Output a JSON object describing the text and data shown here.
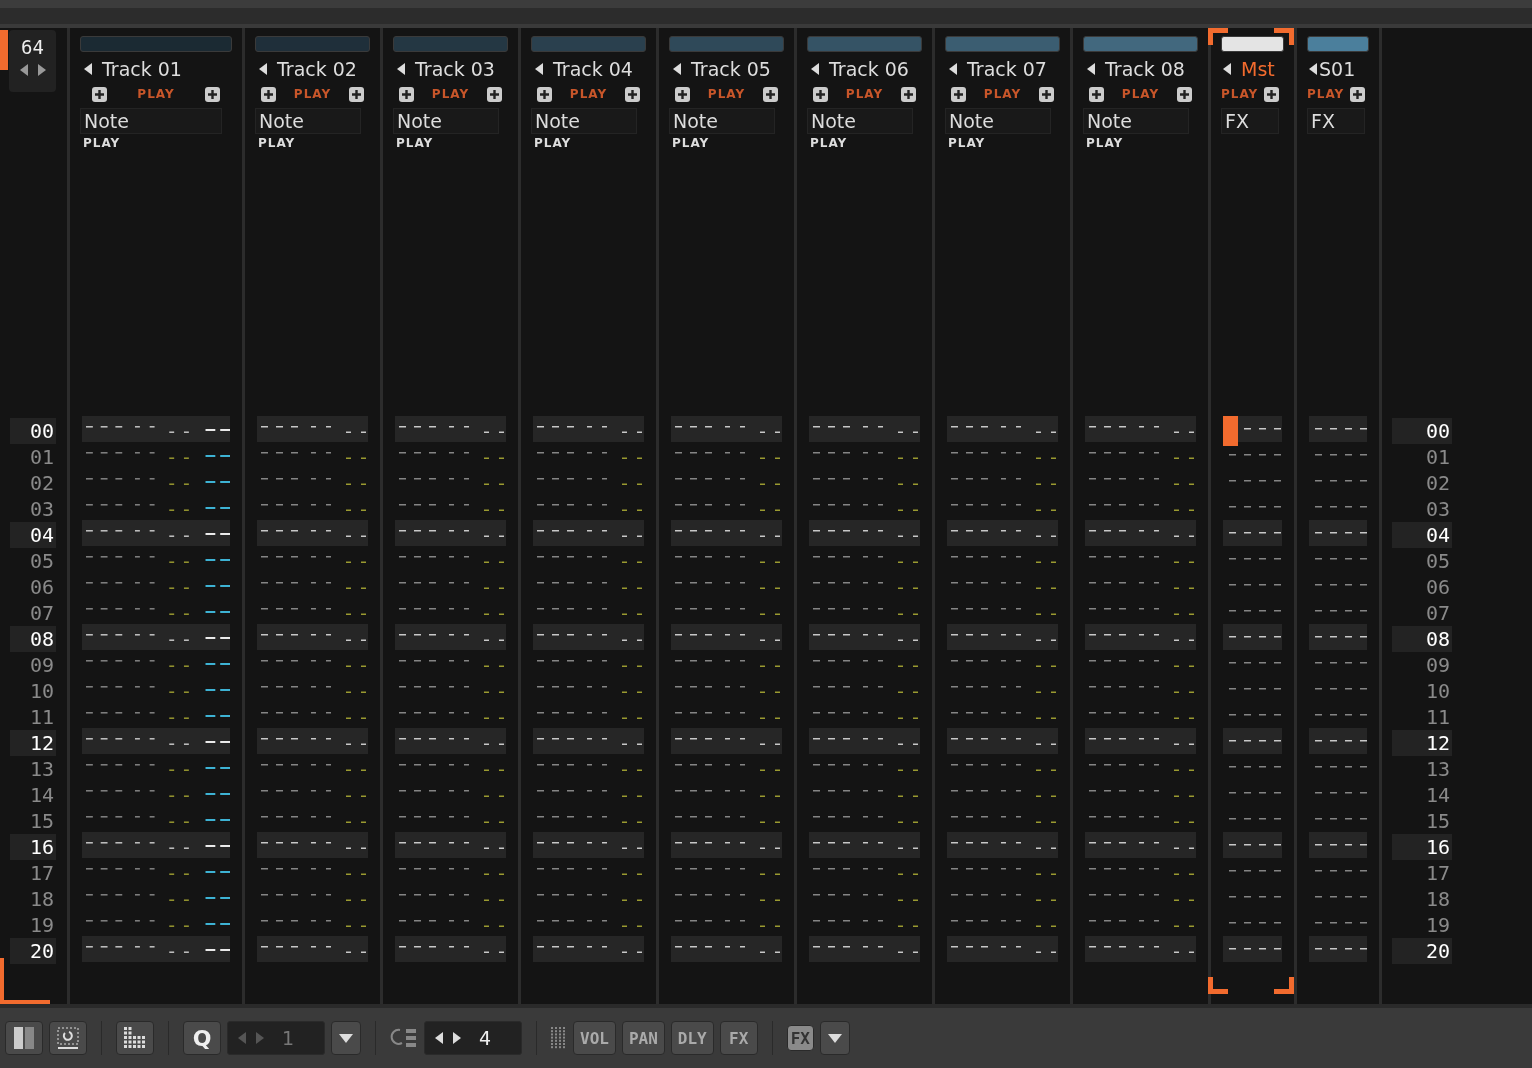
{
  "pattern_length": "64",
  "rows": [
    {
      "label": "00",
      "highlighted": true
    },
    {
      "label": "01",
      "highlighted": false
    },
    {
      "label": "02",
      "highlighted": false
    },
    {
      "label": "03",
      "highlighted": false
    },
    {
      "label": "04",
      "highlighted": true
    },
    {
      "label": "05",
      "highlighted": false
    },
    {
      "label": "06",
      "highlighted": false
    },
    {
      "label": "07",
      "highlighted": false
    },
    {
      "label": "08",
      "highlighted": true
    },
    {
      "label": "09",
      "highlighted": false
    },
    {
      "label": "10",
      "highlighted": false
    },
    {
      "label": "11",
      "highlighted": false
    },
    {
      "label": "12",
      "highlighted": true
    },
    {
      "label": "13",
      "highlighted": false
    },
    {
      "label": "14",
      "highlighted": false
    },
    {
      "label": "15",
      "highlighted": false
    },
    {
      "label": "16",
      "highlighted": true
    },
    {
      "label": "17",
      "highlighted": false
    },
    {
      "label": "18",
      "highlighted": false
    },
    {
      "label": "19",
      "highlighted": false
    },
    {
      "label": "20",
      "highlighted": true
    }
  ],
  "rows_right": [
    {
      "label": "00",
      "highlighted": true
    },
    {
      "label": "01",
      "highlighted": false
    },
    {
      "label": "02",
      "highlighted": false
    },
    {
      "label": "03",
      "highlighted": false
    },
    {
      "label": "04",
      "highlighted": true
    },
    {
      "label": "05",
      "highlighted": false
    },
    {
      "label": "06",
      "highlighted": false
    },
    {
      "label": "07",
      "highlighted": false
    },
    {
      "label": "08",
      "highlighted": true
    },
    {
      "label": "09",
      "highlighted": false
    },
    {
      "label": "10",
      "highlighted": false
    },
    {
      "label": "11",
      "highlighted": false
    },
    {
      "label": "12",
      "highlighted": true
    },
    {
      "label": "13",
      "highlighted": false
    },
    {
      "label": "14",
      "highlighted": false
    },
    {
      "label": "15",
      "highlighted": false
    },
    {
      "label": "16",
      "highlighted": true
    },
    {
      "label": "17",
      "highlighted": false
    },
    {
      "label": "18",
      "highlighted": false
    },
    {
      "label": "19",
      "highlighted": false
    },
    {
      "label": "20",
      "highlighted": true
    }
  ],
  "tracks": [
    {
      "kind": "sequencer",
      "name": "Track 01",
      "color": "#1b2a33",
      "selected": false,
      "state": "PLAY",
      "column": "Note",
      "column_state": "PLAY",
      "extra_column": true
    },
    {
      "kind": "sequencer",
      "name": "Track 02",
      "color": "#1f2f3a",
      "selected": false,
      "state": "PLAY",
      "column": "Note",
      "column_state": "PLAY",
      "extra_column": false
    },
    {
      "kind": "sequencer",
      "name": "Track 03",
      "color": "#243743",
      "selected": false,
      "state": "PLAY",
      "column": "Note",
      "column_state": "PLAY",
      "extra_column": false
    },
    {
      "kind": "sequencer",
      "name": "Track 04",
      "color": "#2a404e",
      "selected": false,
      "state": "PLAY",
      "column": "Note",
      "column_state": "PLAY",
      "extra_column": false
    },
    {
      "kind": "sequencer",
      "name": "Track 05",
      "color": "#2f4959",
      "selected": false,
      "state": "PLAY",
      "column": "Note",
      "column_state": "PLAY",
      "extra_column": false
    },
    {
      "kind": "sequencer",
      "name": "Track 06",
      "color": "#355365",
      "selected": false,
      "state": "PLAY",
      "column": "Note",
      "column_state": "PLAY",
      "extra_column": false
    },
    {
      "kind": "sequencer",
      "name": "Track 07",
      "color": "#3b5d71",
      "selected": false,
      "state": "PLAY",
      "column": "Note",
      "column_state": "PLAY",
      "extra_column": false
    },
    {
      "kind": "sequencer",
      "name": "Track 08",
      "color": "#42687e",
      "selected": false,
      "state": "PLAY",
      "column": "Note",
      "column_state": "PLAY",
      "extra_column": false
    },
    {
      "kind": "master",
      "name": "Mst",
      "color": "#e4e4e4",
      "selected": true,
      "state": "PLAY",
      "column": "FX"
    },
    {
      "kind": "send",
      "name": "S01",
      "color": "#4b7f9c",
      "selected": false,
      "state": "PLAY",
      "column": "FX"
    }
  ],
  "toolbar": {
    "quantize": "Q",
    "edit_step": "1",
    "highlight_lines": "4",
    "column_buttons": [
      {
        "label": "VOL",
        "on": false
      },
      {
        "label": "PAN",
        "on": false
      },
      {
        "label": "DLY",
        "on": false
      },
      {
        "label": "FX",
        "on": false
      }
    ],
    "fx_toggle": {
      "label": "FX",
      "on": true
    }
  }
}
